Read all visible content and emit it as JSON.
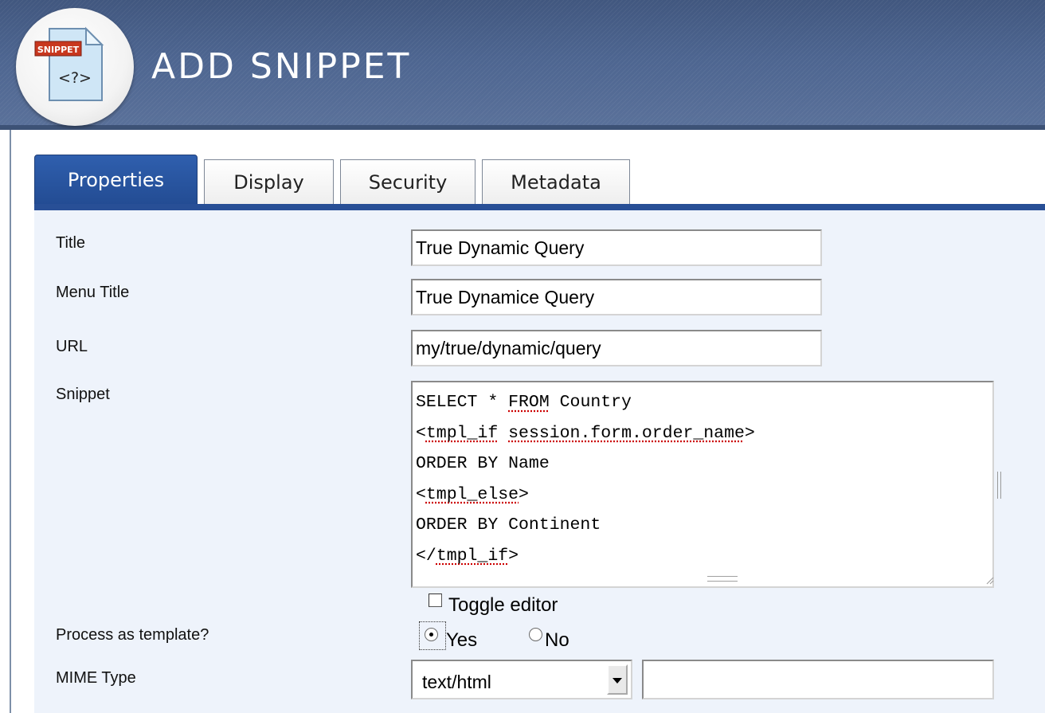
{
  "header": {
    "title": "ADD SNIPPET",
    "logo_badge": "SNIPPET",
    "logo_glyph": "<?>",
    "bg_color": "#4a6190"
  },
  "tabs": [
    {
      "label": "Properties",
      "active": true
    },
    {
      "label": "Display",
      "active": false
    },
    {
      "label": "Security",
      "active": false
    },
    {
      "label": "Metadata",
      "active": false
    }
  ],
  "form": {
    "title": {
      "label": "Title",
      "value": "True Dynamic Query"
    },
    "menu_title": {
      "label": "Menu Title",
      "value": "True Dynamice Query"
    },
    "url": {
      "label": "URL",
      "value": "my/true/dynamic/query"
    },
    "snippet": {
      "label": "Snippet",
      "lines": [
        "SELECT * FROM Country",
        "<tmpl_if session.form.order_name>",
        "ORDER BY Name",
        "<tmpl_else>",
        "ORDER BY Continent",
        "</tmpl_if>"
      ]
    },
    "toggle_editor": {
      "label": "Toggle editor",
      "checked": false
    },
    "process_as_template": {
      "label": "Process as template?",
      "options": [
        {
          "label": "Yes",
          "selected": true
        },
        {
          "label": "No",
          "selected": false
        }
      ]
    },
    "mime_type": {
      "label": "MIME Type",
      "selected": "text/html",
      "custom_value": ""
    }
  },
  "colors": {
    "accent": "#284f96",
    "form_bg": "#eef3fb",
    "spellcheck": "#cc0000"
  }
}
